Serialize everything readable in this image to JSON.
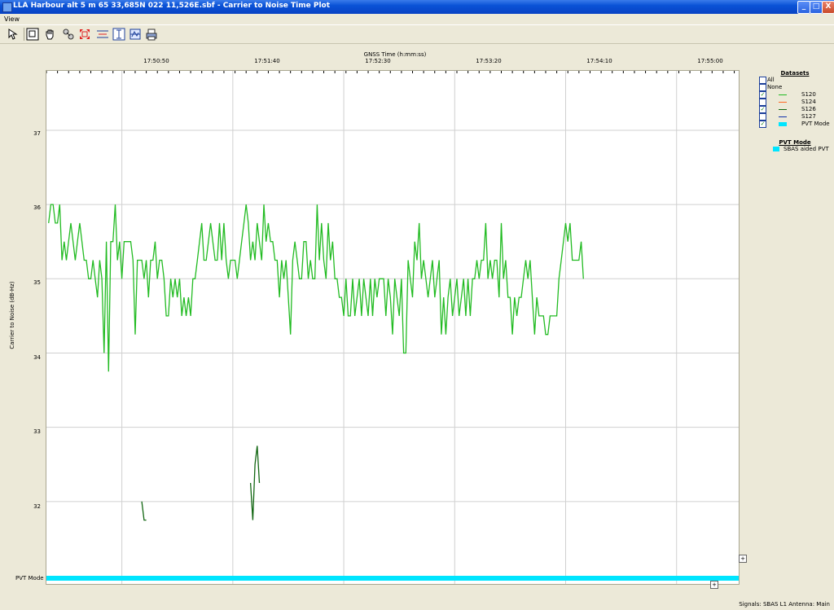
{
  "window": {
    "title": "LLA Harbour alt 5 m 65 33,685N 022 11,526E.sbf - Carrier to Noise Time Plot",
    "minimize_label": "_",
    "maximize_label": "□",
    "close_label": "X"
  },
  "menu": {
    "view": "View"
  },
  "toolbar": {
    "tools": [
      "select-tool",
      "zoom-box-tool",
      "pan-hand-tool",
      "measure-tool",
      "zoom-fit-tool",
      "horizontal-fit-tool",
      "vertical-fit-tool",
      "split-view-tool",
      "print-tool"
    ]
  },
  "axes": {
    "x_title": "GNSS Time (h:mm:ss)",
    "y_title": "Carrier to Noise (dB-Hz)",
    "x_ticks": [
      "17:50:50",
      "17:51:40",
      "17:52:30",
      "17:53:20",
      "17:54:10",
      "17:55:00"
    ],
    "y_ticks": [
      "37",
      "36",
      "35",
      "34",
      "33",
      "32"
    ],
    "pvt_row_label": "PVT Mode"
  },
  "chart_data": {
    "type": "line",
    "title": "",
    "xlabel": "GNSS Time (h:mm:ss)",
    "ylabel": "Carrier to Noise (dB-Hz)",
    "xlim": [
      "17:50:16",
      "17:55:28"
    ],
    "ylim": [
      31,
      37.8
    ],
    "grid": true,
    "legend": "right",
    "x_ticks": [
      "17:50:50",
      "17:51:40",
      "17:52:30",
      "17:53:20",
      "17:54:10",
      "17:55:00"
    ],
    "y_ticks": [
      32,
      33,
      34,
      35,
      36,
      37
    ],
    "series": [
      {
        "name": "S120",
        "color": "#22bb22",
        "x_start": "17:50:17",
        "x_step_s": 1,
        "values": [
          35.75,
          36.0,
          36.0,
          35.75,
          35.75,
          36.0,
          35.25,
          35.5,
          35.25,
          35.5,
          35.75,
          35.5,
          35.25,
          35.5,
          35.75,
          35.5,
          35.25,
          35.25,
          35.0,
          35.0,
          35.25,
          35.0,
          34.75,
          35.25,
          35.0,
          34.0,
          35.5,
          33.75,
          35.5,
          35.5,
          36.0,
          35.25,
          35.5,
          35.0,
          35.5,
          35.5,
          35.5,
          35.5,
          35.25,
          34.25,
          35.25,
          35.25,
          35.25,
          35.0,
          35.25,
          34.75,
          35.25,
          35.25,
          35.5,
          35.0,
          35.25,
          35.25,
          35.0,
          34.5,
          34.5,
          35.0,
          34.75,
          35.0,
          34.75,
          35.0,
          34.5,
          34.75,
          34.5,
          34.75,
          34.5,
          35.0,
          35.0,
          35.25,
          35.5,
          35.75,
          35.25,
          35.25,
          35.5,
          35.75,
          35.5,
          35.25,
          35.25,
          35.75,
          35.25,
          35.75,
          35.25,
          35.0,
          35.25,
          35.25,
          35.25,
          35.0,
          35.25,
          35.5,
          35.75,
          36.0,
          35.75,
          35.25,
          35.5,
          35.25,
          35.75,
          35.5,
          35.25,
          36.0,
          35.5,
          35.75,
          35.5,
          35.5,
          35.25,
          35.25,
          34.75,
          35.25,
          35.0,
          35.25,
          34.75,
          34.25,
          35.25,
          35.5,
          35.25,
          35.0,
          35.0,
          35.5,
          35.5,
          35.0,
          35.25,
          35.0,
          35.0,
          36.0,
          35.25,
          35.75,
          35.25,
          35.0,
          35.75,
          35.25,
          35.5,
          35.0,
          35.0,
          34.75,
          34.75,
          34.5,
          35.0,
          34.5,
          34.5,
          35.0,
          34.5,
          34.75,
          35.0,
          34.5,
          35.0,
          34.75,
          34.5,
          35.0,
          34.5,
          35.0,
          34.75,
          35.0,
          35.0,
          35.0,
          34.5,
          35.0,
          34.75,
          34.25,
          35.0,
          34.75,
          34.5,
          35.0,
          34.0,
          34.0,
          35.25,
          35.0,
          34.75,
          35.5,
          35.25,
          35.75,
          35.0,
          35.25,
          35.0,
          34.75,
          35.0,
          35.25,
          34.75,
          35.0,
          35.25,
          34.25,
          34.75,
          34.25,
          34.75,
          35.0,
          34.5,
          34.75,
          35.0,
          34.5,
          34.75,
          35.0,
          34.5,
          35.0,
          34.5,
          35.0,
          35.0,
          35.25,
          35.0,
          35.25,
          35.25,
          35.75,
          35.0,
          35.25,
          35.0,
          35.25,
          35.25,
          34.75,
          35.75,
          35.0,
          35.25,
          34.75,
          34.75,
          34.25,
          34.75,
          34.5,
          34.75,
          34.75,
          35.0,
          35.25,
          35.0,
          35.25,
          34.75,
          34.25,
          34.75,
          34.5,
          34.5,
          34.5,
          34.25,
          34.25,
          34.5,
          34.5,
          34.5,
          34.5,
          35.0,
          35.25,
          35.5,
          35.75,
          35.5,
          35.75,
          35.25,
          35.25,
          35.25,
          35.25,
          35.5,
          35.0
        ]
      },
      {
        "name": "S124",
        "color": "#ff6622",
        "x_start": "17:50:17",
        "x_step_s": 1,
        "values": []
      },
      {
        "name": "S126",
        "color": "#116611",
        "segments": [
          {
            "x": [
              "17:50:59",
              "17:51:00",
              "17:51:01"
            ],
            "values": [
              32.0,
              31.75,
              31.75
            ]
          },
          {
            "x": [
              "17:51:48",
              "17:51:49",
              "17:51:50",
              "17:51:51",
              "17:51:52"
            ],
            "values": [
              32.25,
              31.75,
              32.5,
              32.75,
              32.25
            ]
          }
        ]
      },
      {
        "name": "S127",
        "color": "#1133aa",
        "x_start": "17:50:17",
        "x_step_s": 1,
        "values": []
      }
    ],
    "pvt_mode": {
      "label": "PVT Mode",
      "value": "SBAS aided PVT",
      "color": "#00e5ff",
      "x_start": "17:50:16",
      "x_end": "17:55:28"
    }
  },
  "legend": {
    "title": "Datasets",
    "all_label": "All",
    "none_label": "None",
    "items": [
      {
        "name": "S120",
        "color": "#22bb22",
        "checked": "✓"
      },
      {
        "name": "S124",
        "color": "#ff6622",
        "checked": ""
      },
      {
        "name": "S126",
        "color": "#116611",
        "checked": "✓"
      },
      {
        "name": "S127",
        "color": "#1133aa",
        "checked": ""
      },
      {
        "name": "PVT Mode",
        "color": "#00e5ff",
        "checked": "✓"
      }
    ],
    "pvt_title": "PVT Mode",
    "pvt_value": "SBAS aided PVT"
  },
  "status": {
    "text": "Signals: SBAS L1    Antenna: Main"
  }
}
